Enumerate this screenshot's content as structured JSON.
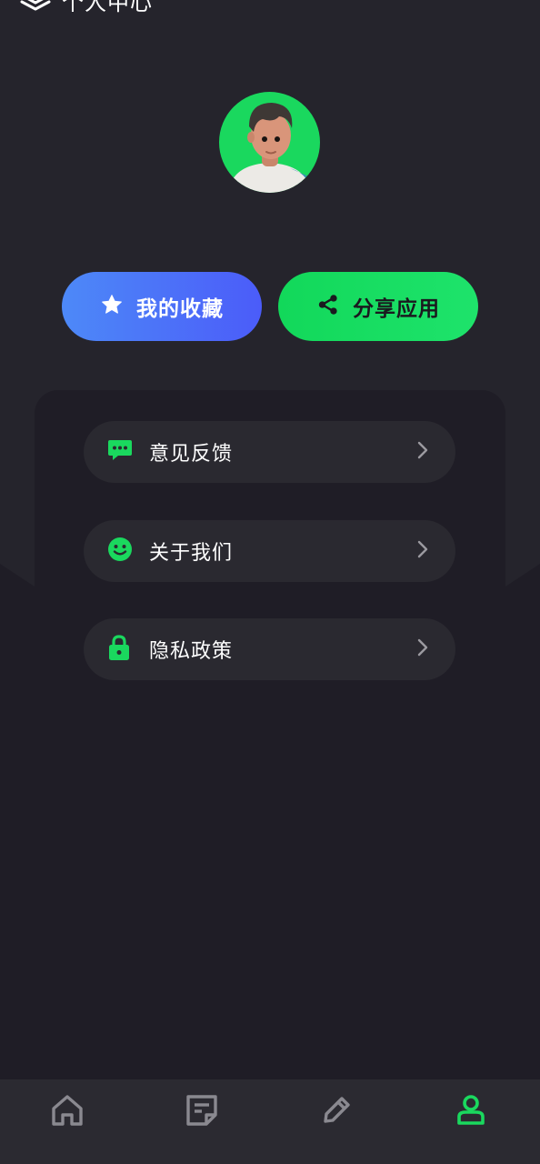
{
  "header": {
    "title": "个人中心",
    "icon": "layers-icon"
  },
  "profile": {
    "avatar": "avatar-3d-boy"
  },
  "actions": {
    "favorites": {
      "label": "我的收藏",
      "icon": "star-icon"
    },
    "share": {
      "label": "分享应用",
      "icon": "share-icon"
    }
  },
  "menu": {
    "items": [
      {
        "label": "意见反馈",
        "icon": "feedback-icon"
      },
      {
        "label": "关于我们",
        "icon": "smile-icon"
      },
      {
        "label": "隐私政策",
        "icon": "lock-icon"
      }
    ]
  },
  "tabbar": {
    "tabs": [
      {
        "name": "home",
        "icon": "home-icon",
        "active": false
      },
      {
        "name": "notes",
        "icon": "note-icon",
        "active": false
      },
      {
        "name": "edit",
        "icon": "pencil-icon",
        "active": false
      },
      {
        "name": "profile",
        "icon": "user-icon",
        "active": true
      }
    ]
  },
  "colors": {
    "accent_green": "#1ad85e",
    "accent_blue": "#4b6ef9",
    "bg_upper": "#25242c",
    "bg_lower": "#1f1d26",
    "item_bg": "#2a2930",
    "tab_inactive": "#8a8990"
  }
}
